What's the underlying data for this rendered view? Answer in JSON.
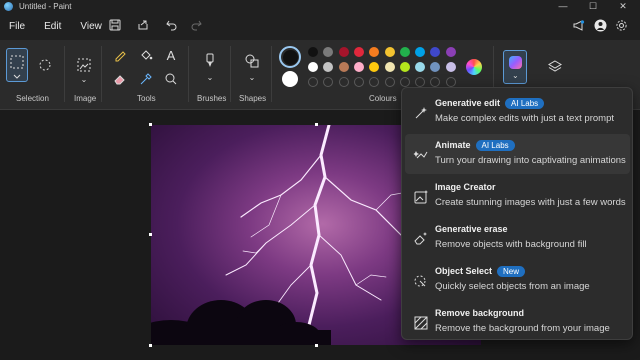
{
  "window": {
    "title": "Untitled - Paint"
  },
  "menu": [
    "File",
    "Edit",
    "View"
  ],
  "ribbon": {
    "groups": [
      "Selection",
      "Image",
      "Tools",
      "Brushes",
      "Shapes",
      "Colours"
    ],
    "palette_row1": [
      "#111111",
      "#7a7a7a",
      "#a5142b",
      "#e0283c",
      "#f57c1f",
      "#f2c230",
      "#22b14c",
      "#00a2e8",
      "#3f48cc",
      "#8b3fb5"
    ],
    "palette_row2": [
      "#ffffff",
      "#c3c3c3",
      "#b97a57",
      "#ffaec9",
      "#ffc90e",
      "#efe4b0",
      "#b5e61d",
      "#99d9ea",
      "#7092be",
      "#c8bfe7"
    ],
    "primary_color": "#111111",
    "secondary_color": "#ffffff"
  },
  "ai_menu": {
    "items": [
      {
        "title": "Generative edit",
        "badge": "AI Labs",
        "desc": "Make complex edits with just a text prompt",
        "icon": "generative-edit-icon"
      },
      {
        "title": "Animate",
        "badge": "AI Labs",
        "desc": "Turn your drawing into captivating animations",
        "icon": "animate-icon"
      },
      {
        "title": "Image Creator",
        "badge": "",
        "desc": "Create stunning images with just a few words",
        "icon": "image-creator-icon"
      },
      {
        "title": "Generative erase",
        "badge": "",
        "desc": "Remove objects with background fill",
        "icon": "generative-erase-icon"
      },
      {
        "title": "Object Select",
        "badge": "New",
        "desc": "Quickly select objects from an image",
        "icon": "object-select-icon"
      },
      {
        "title": "Remove background",
        "badge": "",
        "desc": "Remove the background from your image",
        "icon": "remove-background-icon"
      }
    ]
  }
}
